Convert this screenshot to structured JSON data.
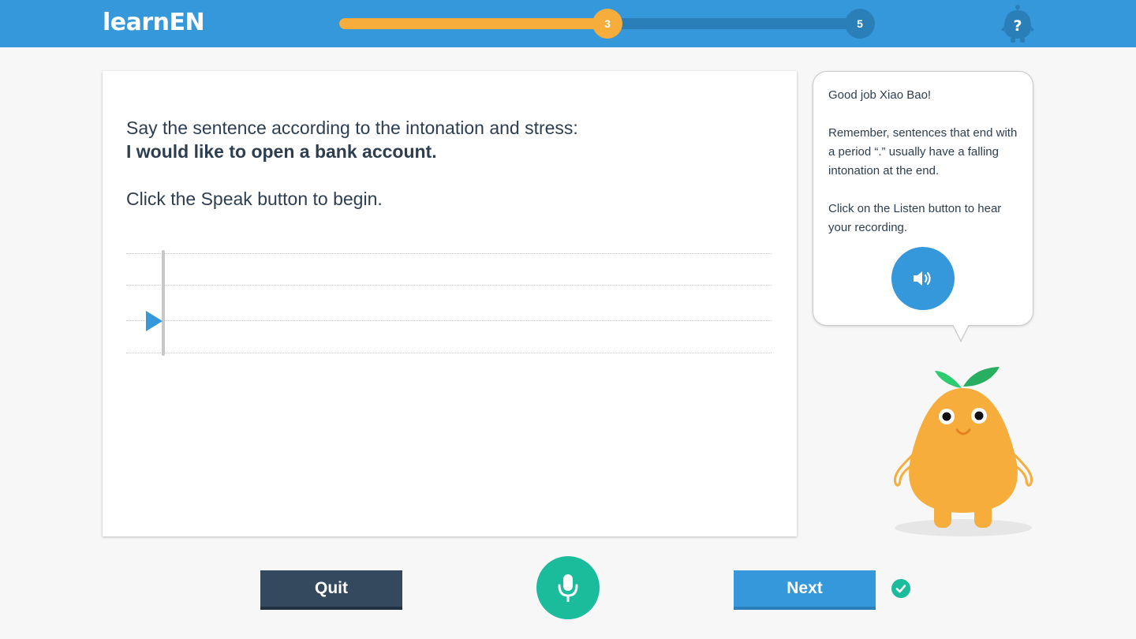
{
  "header": {
    "logo_text": "learnEN",
    "progress": {
      "current_step": "3",
      "total_steps": "5",
      "fraction_complete": 0.5
    },
    "help_label": "?"
  },
  "lesson": {
    "instruction": "Say the sentence according to the intonation and stress:",
    "sentence": "I would like to open a bank account.",
    "hint": "Click the Speak button to begin."
  },
  "feedback": {
    "greeting": "Good job Xiao Bao!",
    "tip": "Remember, sentences that end with a period “.” usually have a falling intonation at the end.",
    "listen_hint": "Click on the Listen button to hear your recording."
  },
  "footer": {
    "quit_label": "Quit",
    "next_label": "Next"
  },
  "colors": {
    "brand_blue": "#3498db",
    "accent_orange": "#f6ad3b",
    "success_green": "#1abc9c",
    "dark_button": "#34495e"
  },
  "icons": [
    "logo",
    "help-icon",
    "play-icon",
    "speaker-icon",
    "microphone-icon",
    "check-icon",
    "mascot"
  ]
}
